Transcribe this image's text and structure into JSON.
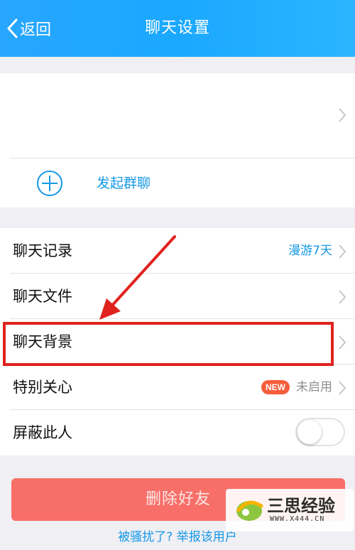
{
  "header": {
    "back_label": "返回",
    "title": "聊天设置"
  },
  "top_card": {
    "friend_name": "",
    "group_chat_label": "发起群聊"
  },
  "settings": {
    "chat_history": {
      "label": "聊天记录",
      "value": "漫游7天"
    },
    "chat_files": {
      "label": "聊天文件"
    },
    "chat_background": {
      "label": "聊天背景"
    },
    "special_care": {
      "label": "特别关心",
      "badge": "NEW",
      "value": "未启用"
    },
    "block_user": {
      "label": "屏蔽此人",
      "enabled": false
    }
  },
  "actions": {
    "delete_friend": "删除好友",
    "report_link": "被骚扰了? 举报该用户"
  },
  "watermark": {
    "brand": "三思经验",
    "url": "WWW.X444.CN"
  },
  "colors": {
    "header_bg": "#1aa8ff",
    "accent_blue": "#1598e6",
    "delete_red": "#f76f68",
    "highlight_red": "#e0221e",
    "badge_orange": "#f65d3b"
  }
}
